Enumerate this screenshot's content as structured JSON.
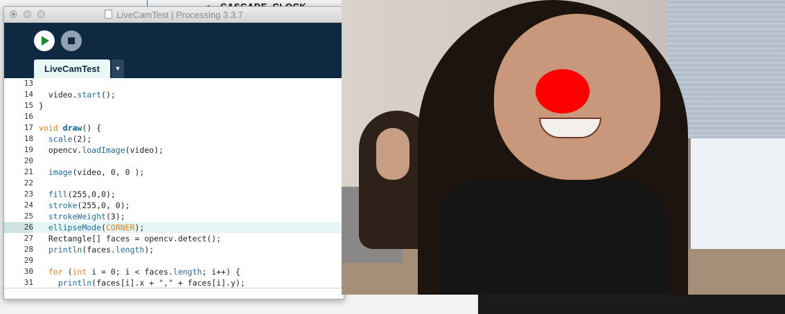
{
  "background": {
    "bullet_text": "CASCADE_CLOCK"
  },
  "window": {
    "title": "LiveCamTest | Processing 3.3.7"
  },
  "toolbar": {
    "run_label": "Run",
    "stop_label": "Stop"
  },
  "tabs": [
    {
      "label": "LiveCamTest"
    }
  ],
  "tab_menu_glyph": "▼",
  "editor": {
    "highlighted_line": 26,
    "lines": [
      {
        "num": "13",
        "text": ""
      },
      {
        "num": "14",
        "text": "  video.start();"
      },
      {
        "num": "15",
        "text": "}"
      },
      {
        "num": "16",
        "text": ""
      },
      {
        "num": "17",
        "text": "void draw() {"
      },
      {
        "num": "18",
        "text": "  scale(2);"
      },
      {
        "num": "19",
        "text": "  opencv.loadImage(video);"
      },
      {
        "num": "20",
        "text": ""
      },
      {
        "num": "21",
        "text": "  image(video, 0, 0 );"
      },
      {
        "num": "22",
        "text": ""
      },
      {
        "num": "23",
        "text": "  fill(255,0,0);"
      },
      {
        "num": "24",
        "text": "  stroke(255,0, 0);"
      },
      {
        "num": "25",
        "text": "  strokeWeight(3);"
      },
      {
        "num": "26",
        "text": "  ellipseMode(CORNER);"
      },
      {
        "num": "27",
        "text": "  Rectangle[] faces = opencv.detect();"
      },
      {
        "num": "28",
        "text": "  println(faces.length);"
      },
      {
        "num": "29",
        "text": ""
      },
      {
        "num": "30",
        "text": "  for (int i = 0; i < faces.length; i++) {"
      },
      {
        "num": "31",
        "text": "    println(faces[i].x + \",\" + faces[i].y);"
      }
    ]
  },
  "colors": {
    "toolbar_bg": "#0f2943",
    "tab_bg": "#e8f9f8",
    "nose": "#ff0000"
  }
}
